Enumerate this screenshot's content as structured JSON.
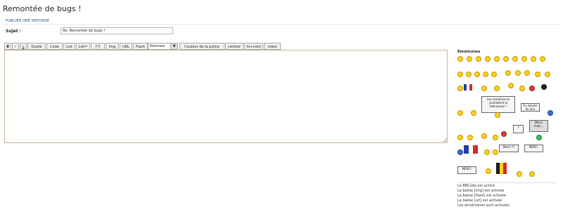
{
  "page": {
    "title": "Remontée de bugs !"
  },
  "form": {
    "section_title": "PUBLIER UNE RÉPONSE",
    "subject_label": "Sujet :",
    "subject_value": "Re: Remontée de bugs !"
  },
  "toolbar": {
    "bold": "B",
    "italic": "i",
    "underline": "u",
    "quote": "Quote",
    "code": "Code",
    "list": "List",
    "list_ordered": "List=",
    "bullet": "[*]",
    "img": "Img",
    "url": "URL",
    "flash": "Flash",
    "size_select": "Normale",
    "font_color": "Couleur de la police",
    "center": "centrer",
    "hr": "hr+cont",
    "video": "video"
  },
  "emoticons": {
    "title": "Émoticônes",
    "signs": {
      "welcome": "Les membres te souhaitent la bienvenue !",
      "top": "Tu, bouter du jour",
      "thanks1": "Merci mais...",
      "thanks2": "Merci !!!",
      "thanks3": "MERCI.",
      "thanks4": "MERCI."
    }
  },
  "bbcode_status": [
    "Le BBCode est activé",
    "La balise [img] est activée",
    "La balise [flash] est activée",
    "La balise [url] est activée",
    "Les émoticônes sont activées"
  ]
}
